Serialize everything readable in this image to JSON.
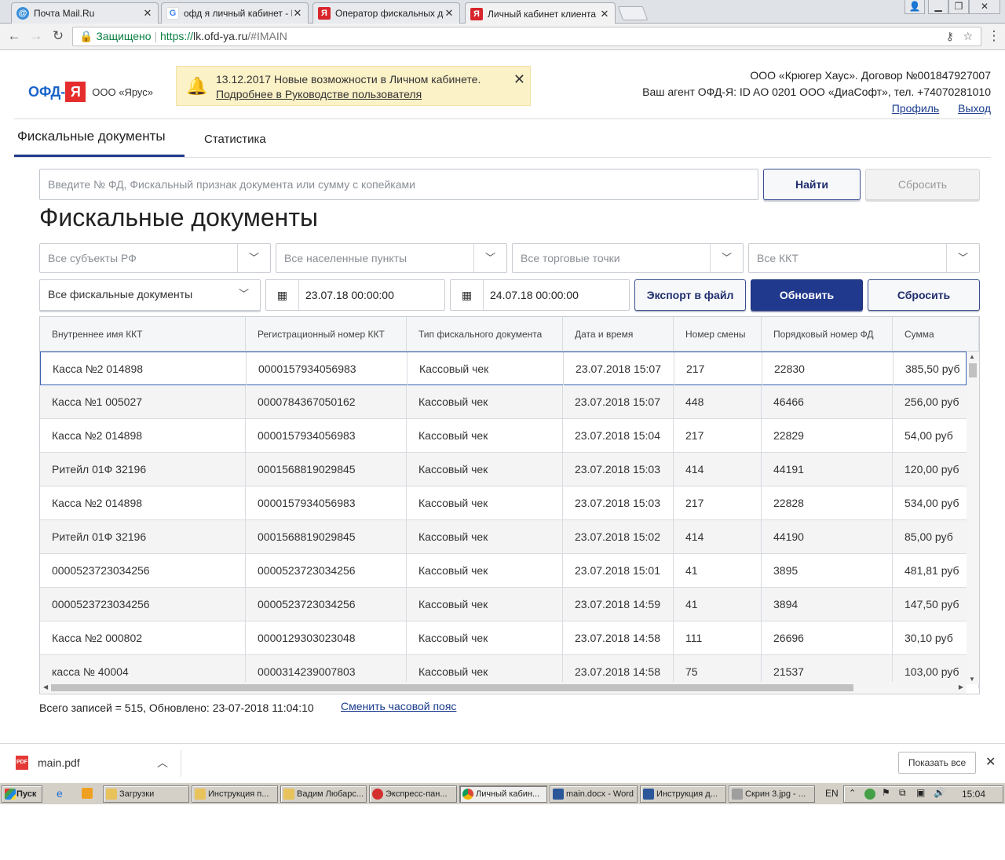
{
  "browser": {
    "tabs": [
      {
        "label": "Почта Mail.Ru",
        "icon": "mailru-icon"
      },
      {
        "label": "офд я личный кабинет - П",
        "icon": "google-icon"
      },
      {
        "label": "Оператор фискальных да",
        "icon": "ofd-ya-icon"
      },
      {
        "label": "Личный кабинет клиента",
        "icon": "ofd-ya-icon"
      }
    ],
    "secure_label": "Защищено",
    "url_scheme": "https://",
    "url_host": "lk.ofd-ya.ru",
    "url_path": "/#IMAIN"
  },
  "header": {
    "logo_text": "ОФД-",
    "logo_letter": "Я",
    "company": "ООО «Ярус»",
    "notification": {
      "date": "13.12.2017",
      "text": "Новые возможности в Личном кабинете.",
      "link": "Подробнее в Руководстве пользователя"
    },
    "org_line": "ООО «Крюгер Хаус». Договор №001847927007",
    "agent_line": "Ваш агент ОФД-Я: ID AO 0201 ООО «ДиаСофт», тел. +74070281010",
    "profile_link": "Профиль",
    "logout_link": "Выход"
  },
  "nav": {
    "tabs": [
      "Фискальные документы",
      "Статистика"
    ]
  },
  "search": {
    "placeholder": "Введите № ФД, Фискальный признак документа или сумму с копейками",
    "find_label": "Найти",
    "reset_label": "Сбросить"
  },
  "page_title": "Фискальные документы",
  "filters": {
    "region": "Все субъекты РФ",
    "city": "Все населенные пункты",
    "points": "Все торговые точки",
    "kkt": "Все ККТ",
    "doc_type": "Все фискальные документы",
    "date_from": "23.07.18 00:00:00",
    "date_to": "24.07.18 00:00:00",
    "export_label": "Экспорт в файл",
    "refresh_label": "Обновить",
    "reset_label": "Сбросить"
  },
  "table": {
    "columns": [
      "Внутреннее имя ККТ",
      "Регистрационный номер ККТ",
      "Тип фискального документа",
      "Дата и время",
      "Номер смены",
      "Порядковый номер ФД",
      "Сумма"
    ],
    "rows": [
      [
        "Касса №2 014898",
        "0000157934056983",
        "Кассовый чек",
        "23.07.2018 15:07",
        "217",
        "22830",
        "385,50 руб"
      ],
      [
        "Касса №1 005027",
        "0000784367050162",
        "Кассовый чек",
        "23.07.2018 15:07",
        "448",
        "46466",
        "256,00 руб"
      ],
      [
        "Касса №2 014898",
        "0000157934056983",
        "Кассовый чек",
        "23.07.2018 15:04",
        "217",
        "22829",
        "54,00 руб"
      ],
      [
        "Ритейл 01Ф 32196",
        "0001568819029845",
        "Кассовый чек",
        "23.07.2018 15:03",
        "414",
        "44191",
        "120,00 руб"
      ],
      [
        "Касса №2 014898",
        "0000157934056983",
        "Кассовый чек",
        "23.07.2018 15:03",
        "217",
        "22828",
        "534,00 руб"
      ],
      [
        "Ритейл 01Ф 32196",
        "0001568819029845",
        "Кассовый чек",
        "23.07.2018 15:02",
        "414",
        "44190",
        "85,00 руб"
      ],
      [
        "0000523723034256",
        "0000523723034256",
        "Кассовый чек",
        "23.07.2018 15:01",
        "41",
        "3895",
        "481,81 руб"
      ],
      [
        "0000523723034256",
        "0000523723034256",
        "Кассовый чек",
        "23.07.2018 14:59",
        "41",
        "3894",
        "147,50 руб"
      ],
      [
        "Касса №2 000802",
        "0000129303023048",
        "Кассовый чек",
        "23.07.2018 14:58",
        "111",
        "26696",
        "30,10 руб"
      ],
      [
        "касса № 40004",
        "0000314239007803",
        "Кассовый чек",
        "23.07.2018 14:58",
        "75",
        "21537",
        "103,00 руб"
      ]
    ]
  },
  "footer": {
    "summary": "Всего записей = 515, Обновлено: 23-07-2018 11:04:10",
    "timezone_link": "Сменить часовой пояс"
  },
  "downloads": {
    "file": "main.pdf",
    "show_all": "Показать все"
  },
  "taskbar": {
    "start": "Пуск",
    "items": [
      "Загрузки",
      "Инструкция п...",
      "Вадим Любарс...",
      "Экспресс-пан...",
      "Личный кабин...",
      "main.docx - Word",
      "Инструкция д...",
      "Скрин 3.jpg - ..."
    ],
    "lang": "EN",
    "clock": "15:04"
  }
}
